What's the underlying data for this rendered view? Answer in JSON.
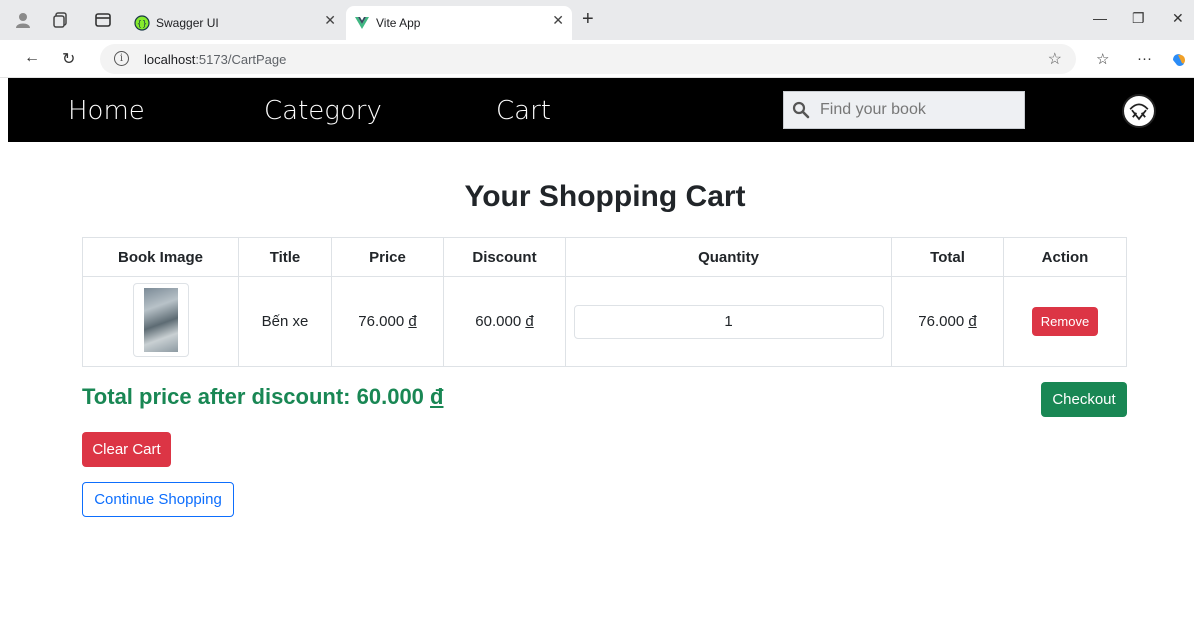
{
  "browser": {
    "tabs": [
      {
        "title": "Swagger UI",
        "active": false,
        "favicon": "swagger-icon"
      },
      {
        "title": "Vite App",
        "active": true,
        "favicon": "vue-icon"
      }
    ],
    "url_host": "localhost",
    "url_rest": ":5173/CartPage"
  },
  "navbar": {
    "home": "Home",
    "category": "Category",
    "cart": "Cart",
    "search_placeholder": "Find your book"
  },
  "page": {
    "title": "Your Shopping Cart"
  },
  "cart_table": {
    "headers": [
      "Book Image",
      "Title",
      "Price",
      "Discount",
      "Quantity",
      "Total",
      "Action"
    ],
    "rows": [
      {
        "title": "Bến xe",
        "price_num": "76.000",
        "discount_num": "60.000",
        "quantity": "1",
        "total_num": "76.000",
        "action": "Remove"
      }
    ],
    "currency": "đ"
  },
  "summary": {
    "total_label": "Total price after discount: 60.000",
    "currency": "đ",
    "checkout": "Checkout",
    "clear": "Clear Cart",
    "continue": "Continue Shopping"
  },
  "colors": {
    "success": "#198754",
    "danger": "#dc3545",
    "primary": "#0d6efd",
    "navbar_bg": "#000000"
  }
}
